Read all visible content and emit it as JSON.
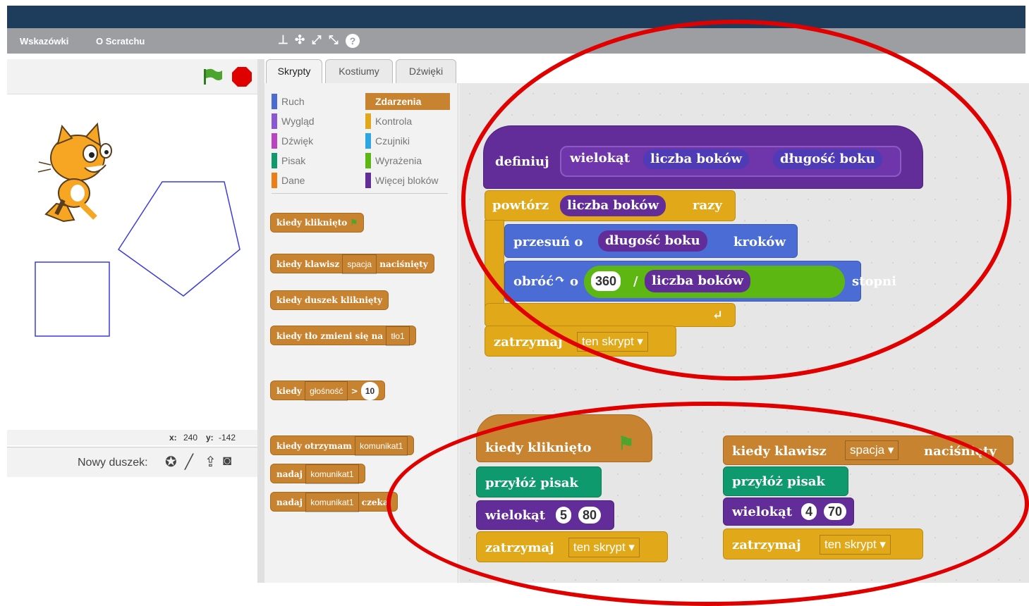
{
  "menu": {
    "tips": "Wskazówki",
    "about": "O Scratchu"
  },
  "toolbar": {
    "duplicate": "⊥",
    "cut": "✣",
    "grow": "⤢",
    "shrink": "⤡",
    "help": "?"
  },
  "stage": {
    "x_label": "x:",
    "x_value": "240",
    "y_label": "y:",
    "y_value": "-142"
  },
  "sprites": {
    "new_sprite_label": "Nowy duszek:"
  },
  "tabs": {
    "scripts": "Skrypty",
    "costumes": "Kostiumy",
    "sounds": "Dźwięki"
  },
  "categories": {
    "motion": "Ruch",
    "looks": "Wygląd",
    "sound": "Dźwięk",
    "pen": "Pisak",
    "data": "Dane",
    "events": "Zdarzenia",
    "control": "Kontrola",
    "sensing": "Czujniki",
    "operators": "Wyrażenia",
    "more": "Więcej bloków"
  },
  "palette": {
    "when_flag": "kiedy kliknięto",
    "when_key": "kiedy klawisz",
    "key_space": "spacja",
    "pressed": "naciśnięty",
    "when_sprite_clicked": "kiedy duszek kliknięty",
    "when_backdrop": "kiedy tło zmieni się na",
    "backdrop_name": "tło1",
    "when_loudness": "kiedy",
    "loudness": "głośność",
    "gt": ">",
    "loudness_value": "10",
    "when_receive": "kiedy otrzymam",
    "message": "komunikat1",
    "broadcast": "nadaj",
    "broadcast_wait_message": "komunikat1",
    "wait": "czekaj"
  },
  "scripts": {
    "define": "definiuj",
    "proc_name": "wielokąt",
    "param_sides": "liczba boków",
    "param_length": "długość boku",
    "repeat": "powtórz",
    "times": "razy",
    "move": "przesuń o",
    "steps": "kroków",
    "turn": "obróć",
    "turn_o": "o",
    "turn_value": "360",
    "divide": "/",
    "degrees": "stopni",
    "stop": "zatrzymaj",
    "stop_option": "ten skrypt",
    "when_flag": "kiedy kliknięto",
    "pen_down": "przyłóż pisak",
    "call1_sides": "5",
    "call1_length": "80",
    "when_key": "kiedy klawisz",
    "key_space": "spacja",
    "pressed": "naciśnięty",
    "call2_sides": "4",
    "call2_length": "70"
  }
}
